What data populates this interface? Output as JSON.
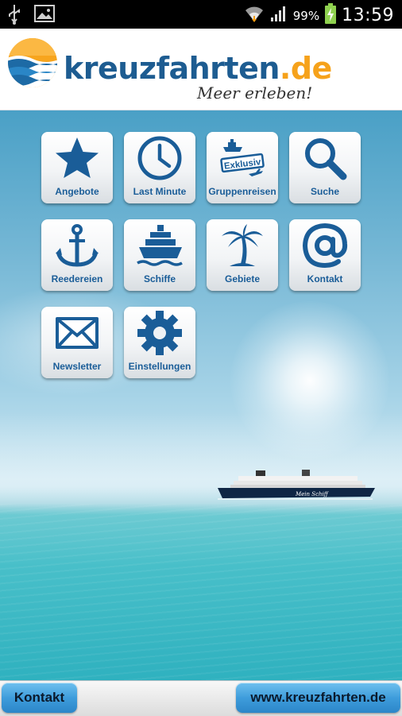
{
  "statusbar": {
    "battery_percent": "99%",
    "time": "13:59",
    "icons": [
      "usb-icon",
      "image-notification-icon",
      "wifi-icon",
      "signal-icon",
      "battery-charging-icon"
    ]
  },
  "header": {
    "brand_name": "kreuzfahrten",
    "brand_tld": ".de",
    "tagline": "Meer erleben!"
  },
  "menu": {
    "tiles": [
      {
        "label": "Angebote",
        "icon": "star-icon"
      },
      {
        "label": "Last Minute",
        "icon": "clock-icon"
      },
      {
        "label": "Gruppenreisen",
        "icon": "group-travel-icon",
        "badge": "Exklusiv"
      },
      {
        "label": "Suche",
        "icon": "magnifier-icon"
      },
      {
        "label": "Reedereien",
        "icon": "anchor-icon"
      },
      {
        "label": "Schiffe",
        "icon": "ship-icon"
      },
      {
        "label": "Gebiete",
        "icon": "palm-tree-icon"
      },
      {
        "label": "Kontakt",
        "icon": "at-sign-icon"
      },
      {
        "label": "Newsletter",
        "icon": "envelope-icon"
      },
      {
        "label": "Einstellungen",
        "icon": "gear-icon"
      }
    ]
  },
  "bottombar": {
    "left_button": "Kontakt",
    "right_button": "www.kreuzfahrten.de"
  },
  "colors": {
    "brand_blue": "#1d5c91",
    "brand_orange": "#f6a21b",
    "button_blue": "#3f9ddc"
  }
}
